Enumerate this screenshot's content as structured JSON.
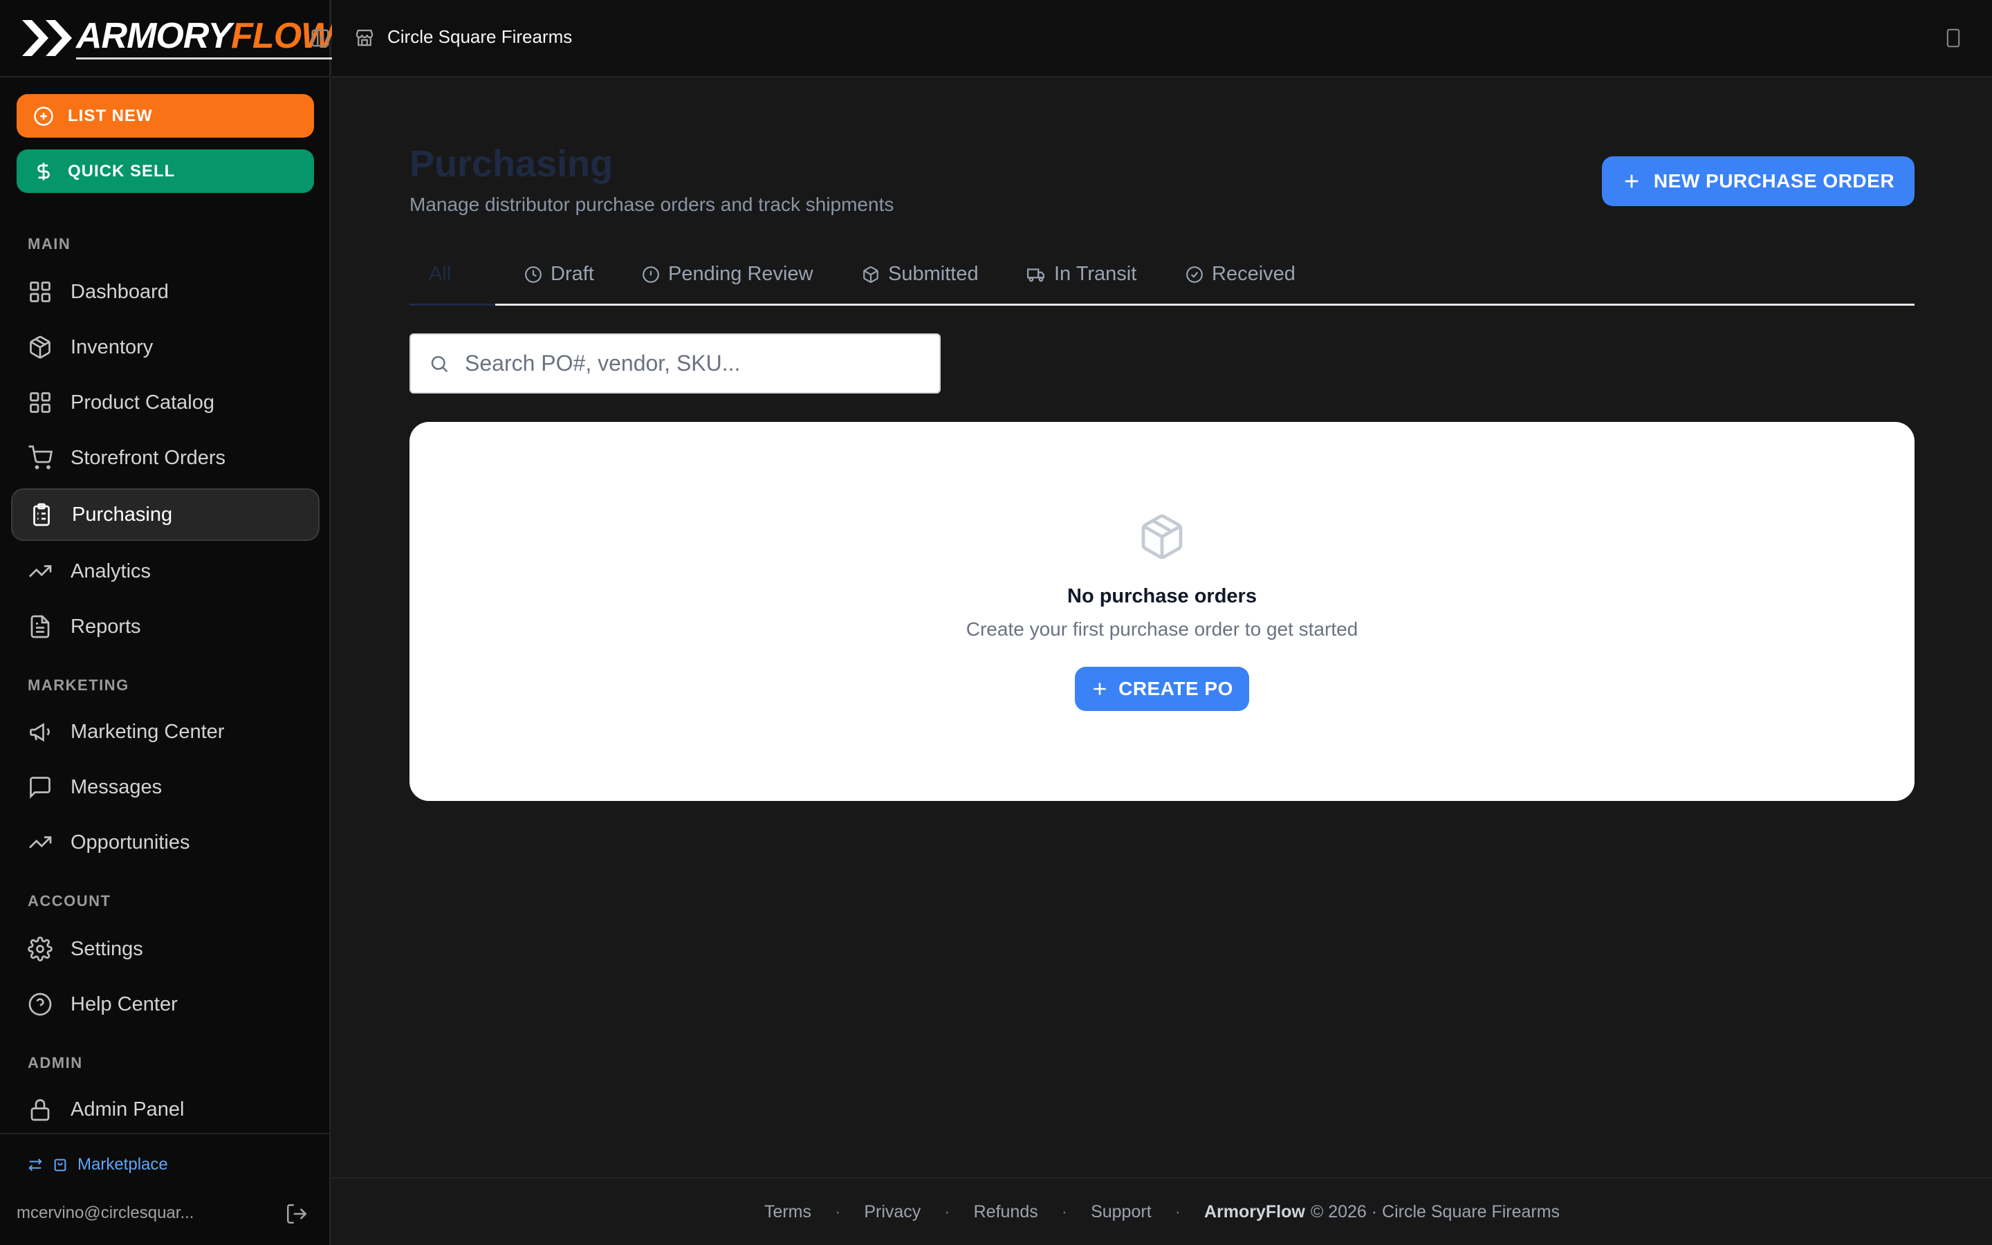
{
  "brand": {
    "logo_white": "ARMORY",
    "logo_orange": "FLOW"
  },
  "sidebar": {
    "list_new": "LIST NEW",
    "quick_sell": "QUICK SELL",
    "sections": {
      "main": "MAIN",
      "marketing": "MARKETING",
      "account": "ACCOUNT",
      "admin": "ADMIN"
    },
    "items": [
      {
        "label": "Dashboard",
        "icon": "grid-icon"
      },
      {
        "label": "Inventory",
        "icon": "box-icon"
      },
      {
        "label": "Product Catalog",
        "icon": "grid-icon"
      },
      {
        "label": "Storefront Orders",
        "icon": "cart-icon"
      },
      {
        "label": "Purchasing",
        "icon": "clipboard-icon",
        "active": true
      },
      {
        "label": "Analytics",
        "icon": "trending-up-icon"
      },
      {
        "label": "Reports",
        "icon": "file-text-icon"
      },
      {
        "label": "Marketing Center",
        "icon": "megaphone-icon"
      },
      {
        "label": "Messages",
        "icon": "message-icon"
      },
      {
        "label": "Opportunities",
        "icon": "trending-up-icon"
      },
      {
        "label": "Settings",
        "icon": "gear-icon"
      },
      {
        "label": "Help Center",
        "icon": "help-circle-icon"
      },
      {
        "label": "Admin Panel",
        "icon": "lock-icon"
      }
    ],
    "marketplace": "Marketplace",
    "user_email": "mcervino@circlesquar..."
  },
  "topbar": {
    "store_name": "Circle Square Firearms"
  },
  "main": {
    "title": "Purchasing",
    "subtitle": "Manage distributor purchase orders and track shipments",
    "new_po_button": "NEW PURCHASE ORDER",
    "tabs": [
      {
        "label": "All",
        "active": true
      },
      {
        "label": "Draft",
        "icon": "clock-icon"
      },
      {
        "label": "Pending Review",
        "icon": "alert-circle-icon"
      },
      {
        "label": "Submitted",
        "icon": "box-icon"
      },
      {
        "label": "In Transit",
        "icon": "truck-icon"
      },
      {
        "label": "Received",
        "icon": "check-circle-icon"
      }
    ],
    "search_placeholder": "Search PO#, vendor, SKU...",
    "empty": {
      "title": "No purchase orders",
      "subtitle": "Create your first purchase order to get started",
      "button": "CREATE PO"
    }
  },
  "footer": {
    "links": [
      "Terms",
      "Privacy",
      "Refunds",
      "Support"
    ],
    "brand": "ArmoryFlow",
    "copyright": "© 2026 · Circle Square Firearms"
  },
  "colors": {
    "accent_orange": "#f97316",
    "accent_green": "#059669",
    "accent_blue": "#3b82f6",
    "background": "#181818",
    "sidebar_bg": "#0b0b0b"
  }
}
